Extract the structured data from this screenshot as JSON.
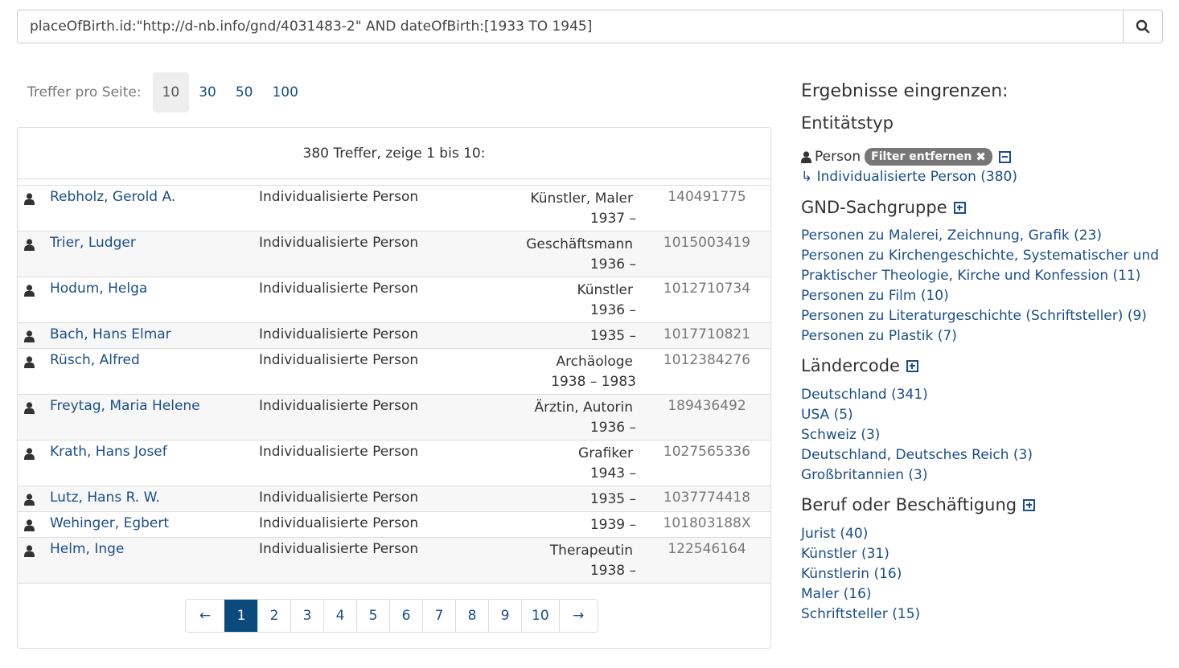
{
  "search": {
    "value": "placeOfBirth.id:\"http://d-nb.info/gnd/4031483-2\" AND dateOfBirth:[1933 TO 1945]",
    "icon": "search-icon"
  },
  "perpage": {
    "label": "Treffer pro Seite:",
    "options": [
      "10",
      "30",
      "50",
      "100"
    ],
    "selected": "10"
  },
  "results": {
    "header": "380 Treffer, zeige 1 bis 10:",
    "rows": [
      {
        "name": "Rebholz, Gerold A.",
        "type": "Individualisierte Person",
        "occupation": "Künstler, Maler",
        "dates": "1937 –",
        "id": "140491775"
      },
      {
        "name": "Trier, Ludger",
        "type": "Individualisierte Person",
        "occupation": "Geschäftsmann",
        "dates": "1936 –",
        "id": "1015003419"
      },
      {
        "name": "Hodum, Helga",
        "type": "Individualisierte Person",
        "occupation": "Künstler",
        "dates": "1936 –",
        "id": "1012710734"
      },
      {
        "name": "Bach, Hans Elmar",
        "type": "Individualisierte Person",
        "occupation": "",
        "dates": "1935 –",
        "id": "1017710821"
      },
      {
        "name": "Rüsch, Alfred",
        "type": "Individualisierte Person",
        "occupation": "Archäologe",
        "dates": "1938 – 1983",
        "id": "1012384276"
      },
      {
        "name": "Freytag, Maria Helene",
        "type": "Individualisierte Person",
        "occupation": "Ärztin, Autorin",
        "dates": "1936 –",
        "id": "189436492"
      },
      {
        "name": "Krath, Hans Josef",
        "type": "Individualisierte Person",
        "occupation": "Grafiker",
        "dates": "1943 –",
        "id": "1027565336"
      },
      {
        "name": "Lutz, Hans R. W.",
        "type": "Individualisierte Person",
        "occupation": "",
        "dates": "1935 –",
        "id": "1037774418"
      },
      {
        "name": "Wehinger, Egbert",
        "type": "Individualisierte Person",
        "occupation": "",
        "dates": "1939 –",
        "id": "101803188X"
      },
      {
        "name": "Helm, Inge",
        "type": "Individualisierte Person",
        "occupation": "Therapeutin",
        "dates": "1938 –",
        "id": "122546164"
      }
    ]
  },
  "pagination": {
    "prev": "←",
    "pages": [
      "1",
      "2",
      "3",
      "4",
      "5",
      "6",
      "7",
      "8",
      "9",
      "10"
    ],
    "current": "1",
    "next": "→"
  },
  "facets": {
    "heading": "Ergebnisse eingrenzen:",
    "entity": {
      "title": "Entitätstyp",
      "selected": "Person",
      "remove_label": "Filter entfernen",
      "sub": "↳ Individualisierte Person (380)"
    },
    "gnd": {
      "title": "GND-Sachgruppe",
      "items": [
        "Personen zu Malerei, Zeichnung, Grafik (23)",
        "Personen zu Kirchengeschichte, Systematischer und",
        "Praktischer Theologie, Kirche und Konfession (11)",
        "Personen zu Film (10)",
        "Personen zu Literaturgeschichte (Schriftsteller) (9)",
        "Personen zu Plastik (7)"
      ]
    },
    "country": {
      "title": "Ländercode",
      "items": [
        "Deutschland (341)",
        "USA (5)",
        "Schweiz (3)",
        "Deutschland, Deutsches Reich (3)",
        "Großbritannien (3)"
      ]
    },
    "profession": {
      "title": "Beruf oder Beschäftigung",
      "items": [
        "Jurist (40)",
        "Künstler (31)",
        "Künstlerin (16)",
        "Maler (16)",
        "Schriftsteller (15)"
      ]
    }
  },
  "colors": {
    "link": "#1a4e86",
    "active_page": "#0b4a7d",
    "badge": "#777777"
  }
}
